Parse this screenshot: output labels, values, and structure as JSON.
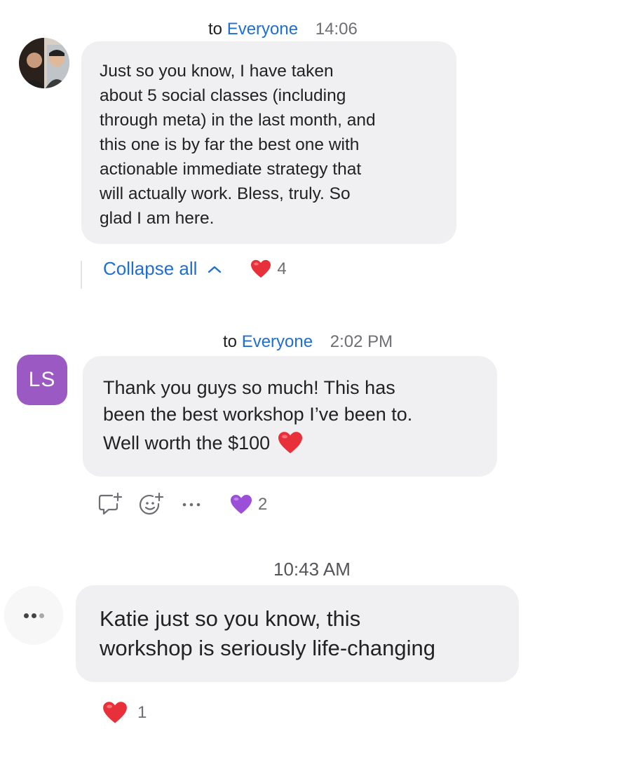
{
  "messages": [
    {
      "to_label": "to",
      "recipient": "Everyone",
      "time": "14:06",
      "avatar_icon": "profile-photo-icon",
      "text": "Just so you know, I have taken\nabout 5 social classes (including\nthrough meta) in the last month, and\nthis one is by far the best one with\nactionable immediate strategy that\nwill actually work. Bless, truly. So\nglad I am here.",
      "collapse_label": "Collapse all",
      "reaction": {
        "emoji": "red-heart",
        "count": "4"
      }
    },
    {
      "to_label": "to",
      "recipient": "Everyone",
      "time": "2:02 PM",
      "avatar_initials": "LS",
      "avatar_color": "#9b59c4",
      "text": "Thank you guys so much! This has\nbeen the best workshop I’ve been to.",
      "text_line3": "Well worth the $100",
      "reaction": {
        "emoji": "purple-heart",
        "count": "2"
      }
    },
    {
      "time": "10:43 AM",
      "avatar_icon": "typing-dots-icon",
      "text": "Katie just so you know, this\nworkshop is seriously life-changing",
      "reaction": {
        "emoji": "red-heart",
        "count": "1"
      }
    }
  ],
  "colors": {
    "link": "#1f6fd1",
    "bubble": "#f0f0f3",
    "red_heart": "#e8303a",
    "purple_heart": "#9b4fd8"
  }
}
